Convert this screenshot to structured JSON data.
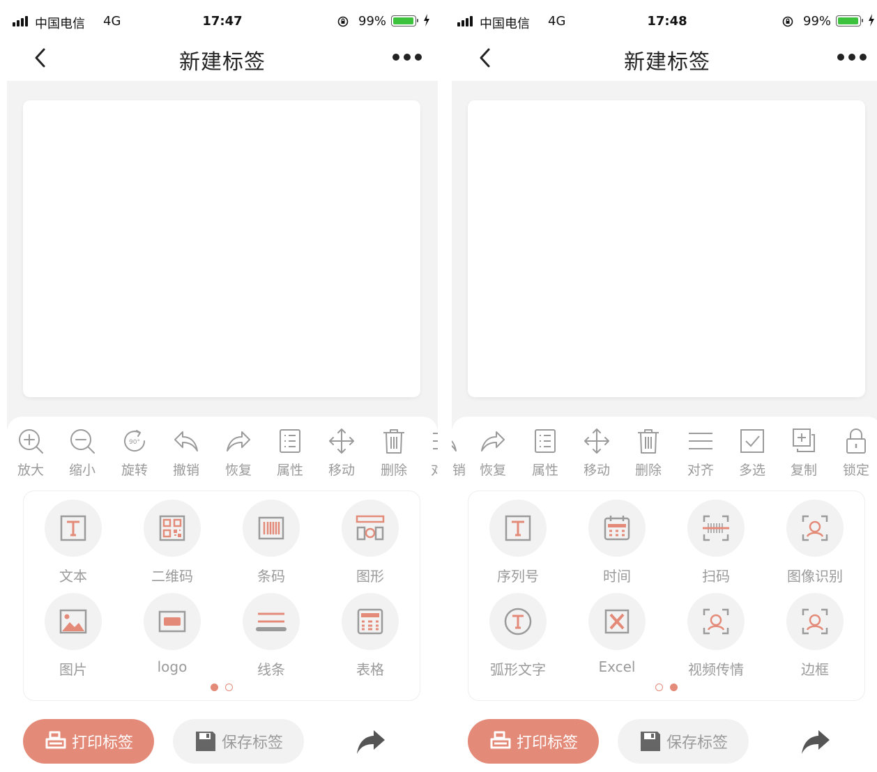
{
  "colors": {
    "accent": "#e48a78",
    "icon_gray": "#9a9a9a",
    "battery_green": "#3cc23c",
    "canvas_bg": "#f3f3f3"
  },
  "screens": [
    {
      "status": {
        "carrier": "中国电信",
        "network": "4G",
        "time": "17:47",
        "battery": "99%"
      },
      "nav": {
        "title": "新建标签"
      },
      "toolbar": [
        {
          "icon": "zoom-in-icon",
          "label": "放大"
        },
        {
          "icon": "zoom-out-icon",
          "label": "缩小"
        },
        {
          "icon": "rotate-icon",
          "label": "旋转"
        },
        {
          "icon": "undo-icon",
          "label": "撤销"
        },
        {
          "icon": "redo-icon",
          "label": "恢复"
        },
        {
          "icon": "properties-icon",
          "label": "属性"
        },
        {
          "icon": "move-icon",
          "label": "移动"
        },
        {
          "icon": "delete-icon",
          "label": "删除"
        },
        {
          "icon": "align-icon",
          "label": "对"
        }
      ],
      "palette": [
        {
          "icon": "text-icon",
          "label": "文本"
        },
        {
          "icon": "qrcode-icon",
          "label": "二维码"
        },
        {
          "icon": "barcode-icon",
          "label": "条码"
        },
        {
          "icon": "shape-icon",
          "label": "图形"
        },
        {
          "icon": "image-icon",
          "label": "图片"
        },
        {
          "icon": "logo-icon",
          "label": "logo"
        },
        {
          "icon": "line-icon",
          "label": "线条"
        },
        {
          "icon": "table-icon",
          "label": "表格"
        }
      ],
      "page_index": 1,
      "page_count": 2,
      "buttons": {
        "print": "打印标签",
        "save": "保存标签"
      }
    },
    {
      "status": {
        "carrier": "中国电信",
        "network": "4G",
        "time": "17:48",
        "battery": "99%"
      },
      "nav": {
        "title": "新建标签"
      },
      "toolbar": [
        {
          "icon": "undo-icon",
          "label": "销"
        },
        {
          "icon": "redo-icon",
          "label": "恢复"
        },
        {
          "icon": "properties-icon",
          "label": "属性"
        },
        {
          "icon": "move-icon",
          "label": "移动"
        },
        {
          "icon": "delete-icon",
          "label": "删除"
        },
        {
          "icon": "align-icon",
          "label": "对齐"
        },
        {
          "icon": "multiselect-icon",
          "label": "多选"
        },
        {
          "icon": "copy-icon",
          "label": "复制"
        },
        {
          "icon": "lock-icon",
          "label": "锁定"
        }
      ],
      "palette": [
        {
          "icon": "text-icon",
          "label": "序列号"
        },
        {
          "icon": "calendar-icon",
          "label": "时间"
        },
        {
          "icon": "scan-icon",
          "label": "扫码"
        },
        {
          "icon": "image-recognition-icon",
          "label": "图像识别"
        },
        {
          "icon": "arc-text-icon",
          "label": "弧形文字"
        },
        {
          "icon": "excel-icon",
          "label": "Excel"
        },
        {
          "icon": "video-icon",
          "label": "视频传情"
        },
        {
          "icon": "border-icon",
          "label": "边框"
        }
      ],
      "page_index": 2,
      "page_count": 2,
      "buttons": {
        "print": "打印标签",
        "save": "保存标签"
      }
    }
  ]
}
